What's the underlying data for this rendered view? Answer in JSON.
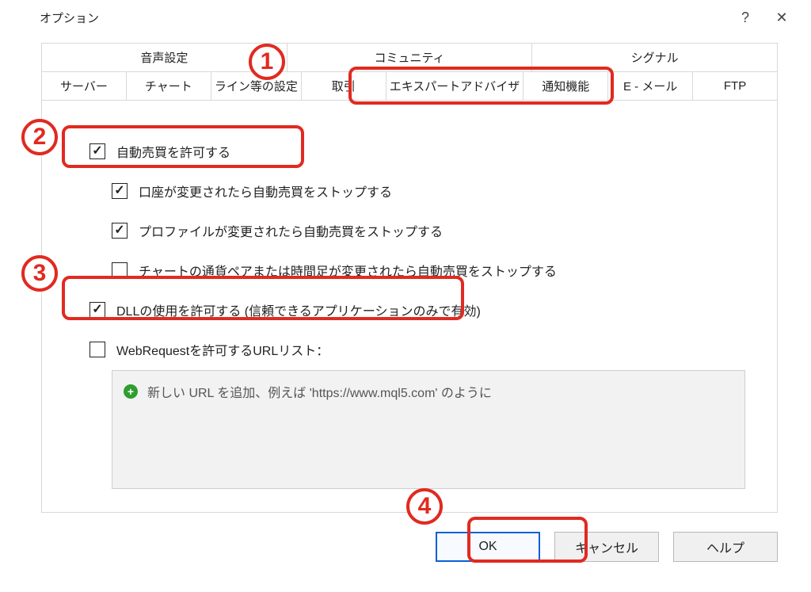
{
  "window": {
    "title": "オプション",
    "help_glyph": "?",
    "close_glyph": "✕"
  },
  "tabs_upper": [
    {
      "label": "音声設定"
    },
    {
      "label": "コミュニティ"
    },
    {
      "label": "シグナル"
    }
  ],
  "tabs_lower": [
    {
      "label": "サーバー"
    },
    {
      "label": "チャート"
    },
    {
      "label": "ライン等の設定"
    },
    {
      "label": "取引"
    },
    {
      "label": "エキスパートアドバイザ",
      "active": true
    },
    {
      "label": "通知機能"
    },
    {
      "label": "E - メール"
    },
    {
      "label": "FTP"
    }
  ],
  "options": {
    "allow_auto_trading": {
      "label": "自動売買を許可する",
      "checked": true
    },
    "stop_on_account_change": {
      "label": "口座が変更されたら自動売買をストップする",
      "checked": true
    },
    "stop_on_profile_change": {
      "label": "プロファイルが変更されたら自動売買をストップする",
      "checked": true
    },
    "stop_on_symbol_tf_change": {
      "label": "チャートの通貨ペアまたは時間足が変更されたら自動売買をストップする",
      "checked": false
    },
    "allow_dll": {
      "label": "DLLの使用を許可する (信頼できるアプリケーションのみで有効)",
      "checked": true
    },
    "allow_webrequest": {
      "label": "WebRequestを許可するURLリスト：",
      "checked": false
    }
  },
  "url_box": {
    "placeholder": "新しい URL を追加、例えば 'https://www.mql5.com' のように"
  },
  "buttons": {
    "ok": "OK",
    "cancel": "キャンセル",
    "help": "ヘルプ"
  },
  "annotations": {
    "b1": "1",
    "b2": "2",
    "b3": "3",
    "b4": "4"
  }
}
